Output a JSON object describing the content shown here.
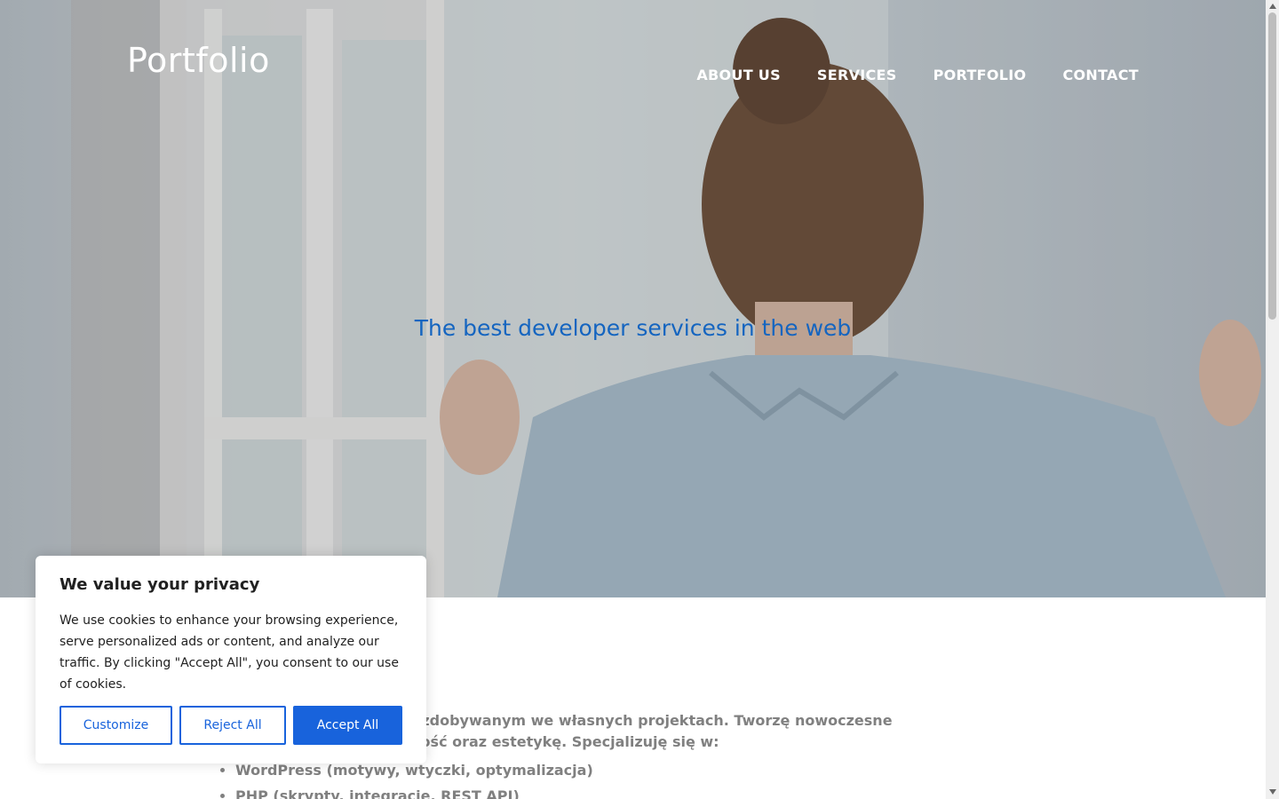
{
  "header": {
    "brand": "Portfolio",
    "nav": [
      "ABOUT US",
      "SERVICES",
      "PORTFOLIO",
      "CONTACT"
    ]
  },
  "hero": {
    "tagline": "The best developer services in the web"
  },
  "content": {
    "intro_line1": "m doświadczeniem zdobywanym we własnych projektach. Tworzę nowoczesne",
    "intro_line2": "bając o funkcjonalność oraz estetykę. Specjalizuję się w:",
    "list": [
      "WordPress (motywy, wtyczki, optymalizacja)",
      "PHP (skrypty, integracje, REST API)"
    ]
  },
  "cookie": {
    "title": "We value your privacy",
    "description": "We use cookies to enhance your browsing experience, serve personalized ads or content, and analyze our traffic. By clicking \"Accept All\", you consent to our use of cookies.",
    "customize": "Customize",
    "reject": "Reject All",
    "accept": "Accept All"
  },
  "colors": {
    "accent": "#1863dc",
    "tagline": "#1565c0"
  }
}
